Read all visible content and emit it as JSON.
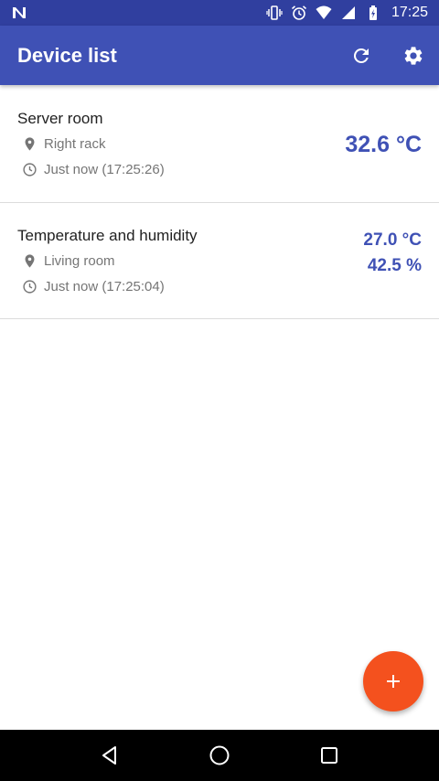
{
  "status_bar": {
    "time": "17:25",
    "icons": [
      "notification-n-icon",
      "vibrate-icon",
      "alarm-icon",
      "wifi-icon",
      "cell-signal-icon",
      "battery-icon"
    ]
  },
  "app_bar": {
    "title": "Device list",
    "actions": [
      "refresh-icon",
      "settings-icon"
    ]
  },
  "devices": [
    {
      "name": "Server room",
      "location": "Right rack",
      "updated": "Just now (17:25:26)",
      "readings": [
        "32.6 °C"
      ]
    },
    {
      "name": "Temperature and humidity",
      "location": "Living room",
      "updated": "Just now (17:25:04)",
      "readings": [
        "27.0 °C",
        "42.5 %"
      ]
    }
  ],
  "fab": {
    "icon": "add-icon"
  },
  "nav_bar": {
    "buttons": [
      "back-icon",
      "home-icon",
      "recents-icon"
    ]
  },
  "colors": {
    "status_bar": "#303f9f",
    "app_bar": "#3f51b5",
    "reading_text": "#3f51b5",
    "fab": "#f4511e",
    "nav_bar": "#000000"
  }
}
